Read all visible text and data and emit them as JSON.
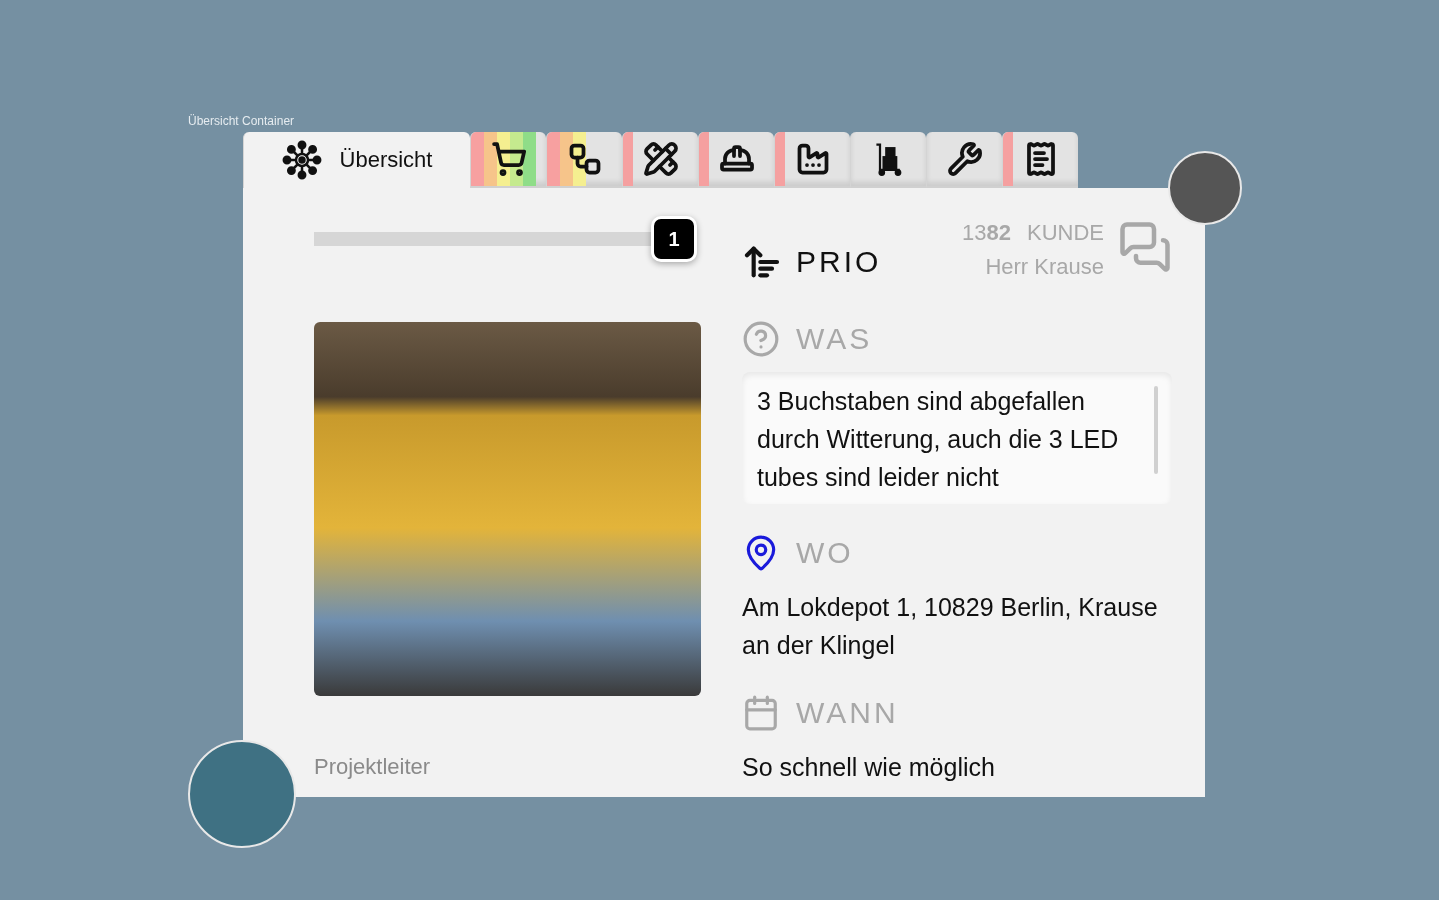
{
  "container_label": "Übersicht Container",
  "tabs": [
    {
      "kind": "overview",
      "label": "Übersicht",
      "selected": true
    },
    {
      "kind": "cart",
      "selected": false,
      "stripes": [
        {
          "color": "#f7a0a0"
        },
        {
          "color": "#f6c48a"
        },
        {
          "color": "#f5ef90"
        },
        {
          "color": "#c5ea8e"
        },
        {
          "color": "#8fdd88"
        }
      ]
    },
    {
      "kind": "workflow",
      "selected": false,
      "stripes": [
        {
          "color": "#f7a0a0"
        },
        {
          "color": "#f6c48a"
        },
        {
          "color": "#f5ef90"
        }
      ]
    },
    {
      "kind": "tools",
      "selected": false,
      "stripes": [
        {
          "color": "#f5a0a0"
        }
      ]
    },
    {
      "kind": "helmet",
      "selected": false,
      "stripes": [
        {
          "color": "#f5a0a0"
        }
      ]
    },
    {
      "kind": "factory",
      "selected": false,
      "stripes": [
        {
          "color": "#f5a0a0"
        }
      ]
    },
    {
      "kind": "handtruck",
      "selected": false
    },
    {
      "kind": "wrench",
      "selected": false
    },
    {
      "kind": "receipt",
      "selected": false,
      "stripes": [
        {
          "color": "#f5a0a0"
        }
      ]
    }
  ],
  "priority": {
    "level": 1,
    "value": "1",
    "label": "PRIO"
  },
  "customer": {
    "number": "13**82**",
    "label": "KUNDE",
    "name": "Herr Krause"
  },
  "project_lead": "Projektleiter",
  "sections": [
    {
      "kind": "what",
      "title": "WAS",
      "text": "3 Buchstaben sind abgefallen durch Witterung, auch die 3 LED tubes sind leider nicht"
    },
    {
      "kind": "where",
      "title": "WO",
      "text": "Am Lokdepot 1, 10829 Berlin, Krause an der Klingel"
    },
    {
      "kind": "when",
      "title": "WANN",
      "text": "So schnell wie möglich"
    }
  ]
}
